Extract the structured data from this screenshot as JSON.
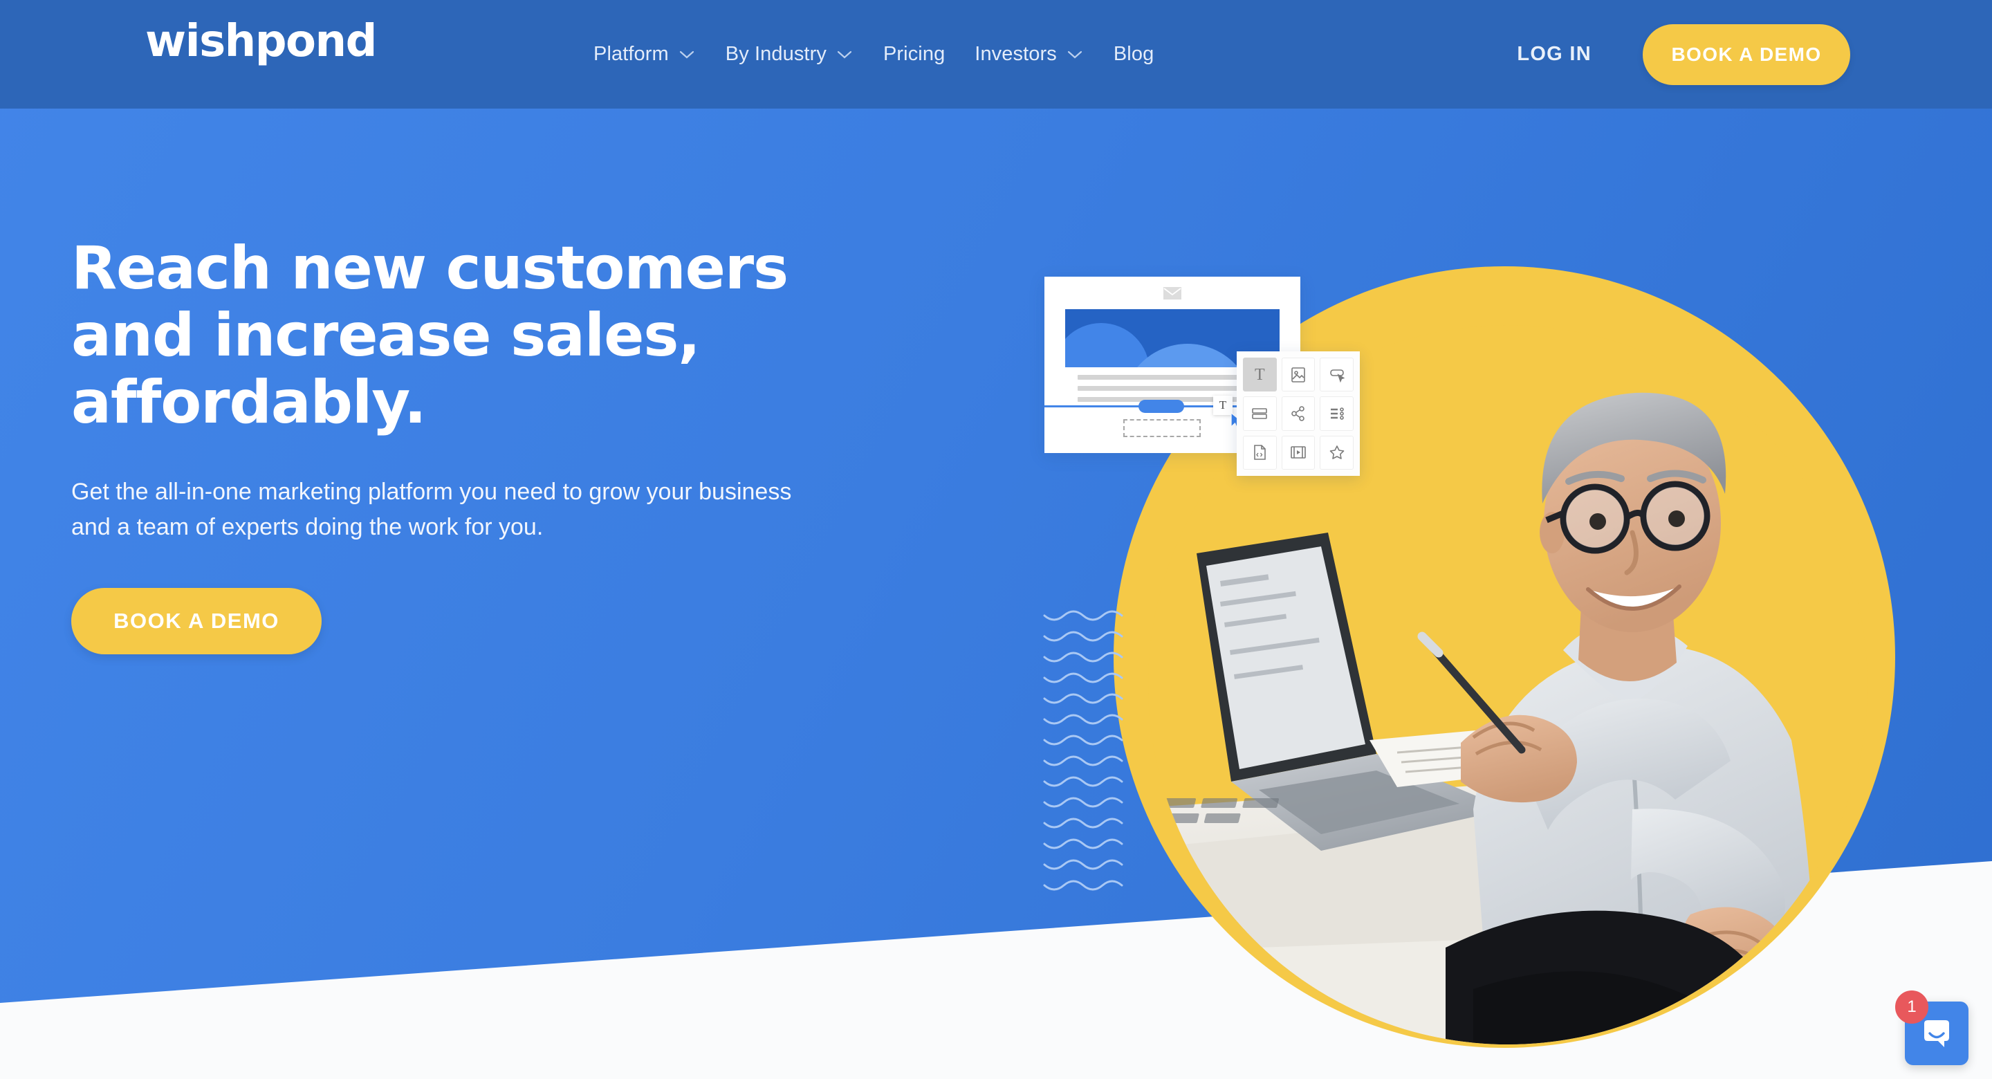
{
  "brand": {
    "logo_text": "wishpond",
    "navbar_color": "#2D66B8",
    "hero_color": "#3B7DE0",
    "accent_yellow": "#F5C947",
    "badge_red": "#E8585C"
  },
  "navbar": {
    "links": [
      {
        "label": "Platform",
        "has_dropdown": true
      },
      {
        "label": "By Industry",
        "has_dropdown": true
      },
      {
        "label": "Pricing",
        "has_dropdown": false
      },
      {
        "label": "Investors",
        "has_dropdown": true
      },
      {
        "label": "Blog",
        "has_dropdown": false
      }
    ],
    "login_label": "LOG IN",
    "cta_label": "BOOK A DEMO"
  },
  "hero": {
    "headline": "Reach new customers and increase sales, affordably.",
    "subheadline": "Get the all-in-one marketing platform you need to grow your business and a team of experts doing the work for you.",
    "cta_label": "BOOK A DEMO"
  },
  "illustration": {
    "palette_icons": [
      "text-icon",
      "image-icon",
      "button-icon",
      "layout-rows-icon",
      "share-icon",
      "list-icon",
      "code-file-icon",
      "video-icon",
      "star-icon"
    ],
    "editor_text_tool": "T",
    "envelope_icon": "envelope-icon",
    "cursor_icon": "cursor-arrow-icon"
  },
  "chat_widget": {
    "unread_count": "1",
    "icon": "chat-bubble-icon"
  }
}
